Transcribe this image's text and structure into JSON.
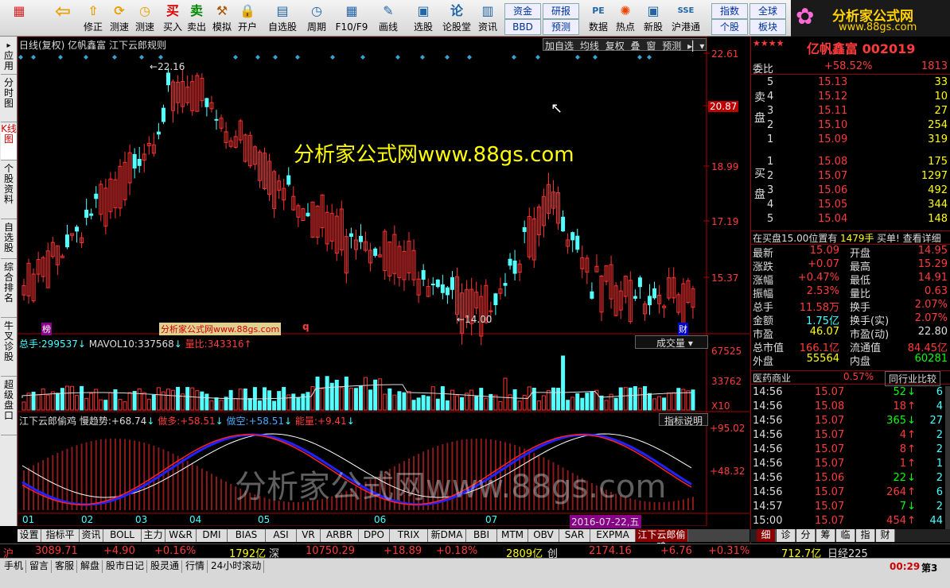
{
  "toolbar": {
    "buttons": [
      {
        "label": "修正",
        "icon": "⇧"
      },
      {
        "label": "测速",
        "icon": "⟳"
      },
      {
        "label": "买入",
        "icon": "买"
      },
      {
        "label": "卖出",
        "icon": "卖"
      },
      {
        "label": "模拟",
        "icon": "⚒"
      },
      {
        "label": "开户",
        "icon": "🔒"
      },
      {
        "label": "自选股",
        "icon": "▤"
      },
      {
        "label": "周期",
        "icon": "◷"
      },
      {
        "label": "F10/F9",
        "icon": "▦"
      },
      {
        "label": "画线",
        "icon": "✎"
      },
      {
        "label": "选股",
        "icon": "▣"
      },
      {
        "label": "论股堂",
        "icon": "论"
      },
      {
        "label": "资讯",
        "icon": "▥"
      },
      {
        "label": "数据",
        "icon": "PE"
      },
      {
        "label": "热点",
        "icon": "✺"
      },
      {
        "label": "新股",
        "icon": "▣"
      },
      {
        "label": "沪港通",
        "icon": "SSE"
      }
    ],
    "boxes": [
      "资金",
      "研报",
      "BBD",
      "预测",
      "指数",
      "全球",
      "个股",
      "板块"
    ],
    "logo_text": "分析家公式网",
    "logo_url": "www.88gs.com"
  },
  "leftnav": [
    "应用",
    "分时图",
    "K线图",
    "个股资料",
    "自选股",
    "综合排名",
    "牛叉诊股",
    "超级盘口"
  ],
  "chart": {
    "header": "日线(复权)  亿帆鑫富 江下云郎规则",
    "menu": [
      "加自选",
      "均线",
      "复权",
      "叠",
      "窗",
      "预测"
    ],
    "price_ticks": [
      "22.61",
      "20.87",
      "18.99",
      "17.19",
      "15.37"
    ],
    "hi_label": "22.16",
    "lo_label": "14.00",
    "watermark": "分析家公式网www.88gs.com",
    "vol_header": {
      "zongshou_label": "总手:",
      "zongshou": "299537",
      "mavol_label": "MAVOL10:",
      "mavol": "337568",
      "liangbi_label": "量比:",
      "liangbi": "343316"
    },
    "vol_button": "成交量",
    "vol_ticks": [
      "67525",
      "33762",
      "X10"
    ],
    "ind_header": {
      "name": "江下云郎偷鸡",
      "t1": "慢趋势:",
      "v1": "+68.74",
      "t2": "做多:",
      "v2": "+58.51",
      "t3": "做空:",
      "v3": "+58.51",
      "t4": "能量:",
      "v4": "+9.41"
    },
    "ind_button": "指标说明",
    "ind_ticks": [
      "+95.02",
      "+48.32"
    ],
    "months": [
      "01",
      "02",
      "03",
      "04",
      "05",
      "06",
      "07"
    ],
    "date_label": "2016-07-22,五",
    "marks": [
      "榜",
      "q",
      "财"
    ],
    "wm2": "分析家公式网www.88gs.com",
    "colors": {
      "up": "#ff3232",
      "down": "#54ffff",
      "accent": "#ff00ff"
    }
  },
  "right": {
    "title": "亿帆鑫富 002019",
    "weibi_label": "委比",
    "weibi": "+58.52%",
    "weicha": "1813",
    "sell_label": [
      "卖",
      "盘"
    ],
    "buy_label": [
      "买",
      "盘"
    ],
    "sell": [
      [
        "5",
        "15.13",
        "33"
      ],
      [
        "4",
        "15.12",
        "10"
      ],
      [
        "3",
        "15.11",
        "27"
      ],
      [
        "2",
        "15.10",
        "254"
      ],
      [
        "1",
        "15.09",
        "319"
      ]
    ],
    "buy": [
      [
        "1",
        "15.08",
        "175"
      ],
      [
        "2",
        "15.07",
        "1297"
      ],
      [
        "3",
        "15.06",
        "492"
      ],
      [
        "4",
        "15.05",
        "344"
      ],
      [
        "5",
        "15.04",
        "148"
      ]
    ],
    "notice": "在买盘15.00位置有",
    "notice_vol": "1479手",
    "notice_tail": "买单! 查看详细",
    "quote": [
      [
        "最新",
        "15.09",
        "开盘",
        "14.95"
      ],
      [
        "涨跌",
        "+0.07",
        "最高",
        "15.29"
      ],
      [
        "涨幅",
        "+0.47%",
        "最低",
        "14.91"
      ],
      [
        "振幅",
        "2.53%",
        "量比",
        "0.63"
      ],
      [
        "总手",
        "11.58万",
        "换手",
        "2.07%"
      ],
      [
        "金额",
        "1.75亿",
        "换手(实)",
        "2.07%"
      ],
      [
        "市盈",
        "46.07",
        "市盈(动)",
        "22.80"
      ],
      [
        "总市值",
        "166.1亿",
        "流通值",
        "84.45亿"
      ],
      [
        "外盘",
        "55564",
        "内盘",
        "60281"
      ]
    ],
    "industry": "医药商业",
    "industry_pct": "0.57%",
    "industry_btn": "同行业比较",
    "ticks": [
      [
        "14:56",
        "15.07",
        "52",
        "↓",
        "6"
      ],
      [
        "14:56",
        "15.08",
        "18",
        "↑",
        "4"
      ],
      [
        "14:56",
        "15.07",
        "365",
        "↓",
        "27"
      ],
      [
        "14:56",
        "15.07",
        "4",
        "↑",
        "2"
      ],
      [
        "14:56",
        "15.07",
        "8",
        "↑",
        "2"
      ],
      [
        "14:56",
        "15.07",
        "1",
        "↑",
        "1"
      ],
      [
        "14:56",
        "15.06",
        "22",
        "↓",
        "2"
      ],
      [
        "14:56",
        "15.07",
        "264",
        "↑",
        "6"
      ],
      [
        "14:57",
        "15.07",
        "7",
        "↓",
        "2"
      ],
      [
        "15:00",
        "15.07",
        "454",
        "↑",
        "44"
      ]
    ]
  },
  "tabs": [
    "设置",
    "指标平台",
    "资讯",
    "BOLL",
    "主力",
    "W&R",
    "DMI",
    "BIAS",
    "ASI",
    "VR",
    "ARBR",
    "DPO",
    "TRIX",
    "新DMA",
    "BBI",
    "MTM",
    "OBV",
    "SAR",
    "EXPMA",
    "江下云郎偷鸡"
  ],
  "rtabs": [
    "细",
    "诊",
    "分",
    "筹",
    "临",
    "指",
    "财"
  ],
  "index": {
    "sh_label": "沪",
    "sh": "3089.71",
    "sh_chg": "+4.90",
    "sh_pct": "+0.16%",
    "sh_amt": "1792亿",
    "sz_label": "深",
    "sz": "10750.29",
    "sz_chg": "+18.89",
    "sz_pct": "+0.18%",
    "sz_amt": "2809亿",
    "cy_label": "创",
    "cy": "2174.16",
    "cy_chg": "+6.76",
    "cy_pct": "+0.31%",
    "cy_amt": "712.7亿",
    "nk_label": "日经225"
  },
  "status": {
    "items": [
      "手机",
      "留言",
      "客服",
      "解盘",
      "股市日记",
      "股灵通",
      "行情",
      "24小时滚动"
    ],
    "time": "00:29",
    "page": "第3"
  }
}
